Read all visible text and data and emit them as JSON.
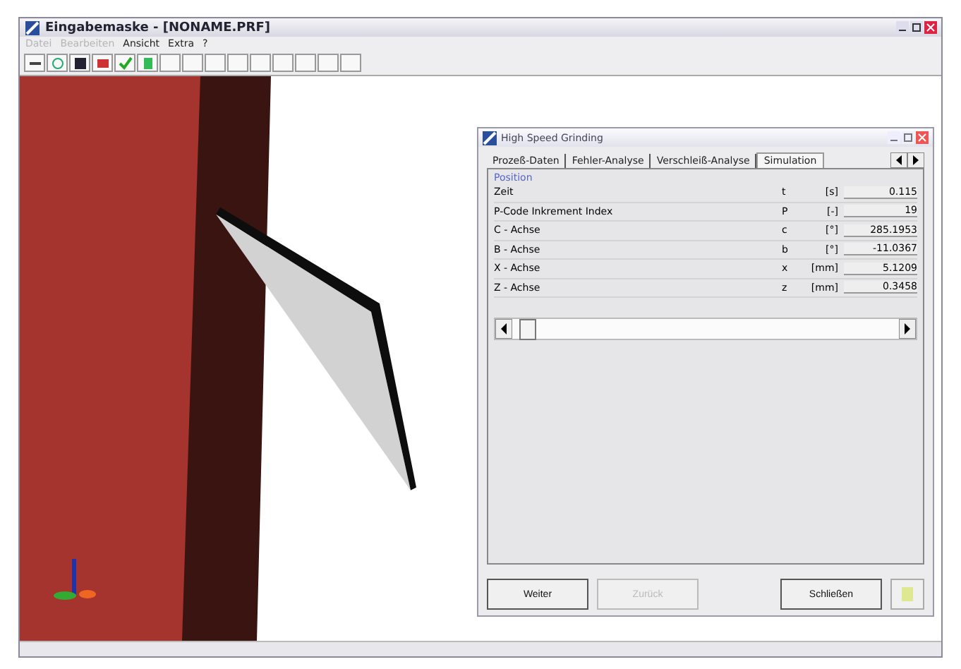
{
  "window": {
    "title": "Eingabemaske - [NONAME.PRF]"
  },
  "menu": [
    {
      "label": "Datei",
      "disabled": true
    },
    {
      "label": "Bearbeiten",
      "disabled": true
    },
    {
      "label": "Ansicht",
      "disabled": false
    },
    {
      "label": "Extra",
      "disabled": false
    },
    {
      "label": "?",
      "disabled": false
    }
  ],
  "dialog": {
    "title": "High Speed Grinding",
    "tabs": [
      {
        "label": "Prozeß-Daten",
        "selected": false
      },
      {
        "label": "Fehler-Analyse",
        "selected": false
      },
      {
        "label": "Verschleiß-Analyse",
        "selected": false
      },
      {
        "label": "Simulation",
        "selected": true
      }
    ],
    "group": "Position",
    "rows": [
      {
        "name": "Zeit",
        "symbol": "t",
        "unit": "[s]",
        "value": "0.115"
      },
      {
        "name": "P-Code Inkrement Index",
        "symbol": "P",
        "unit": "[-]",
        "value": "19"
      },
      {
        "name": "C - Achse",
        "symbol": "c",
        "unit": "[°]",
        "value": "285.1953"
      },
      {
        "name": "B - Achse",
        "symbol": "b",
        "unit": "[°]",
        "value": "-11.0367"
      },
      {
        "name": "X - Achse",
        "symbol": "x",
        "unit": "[mm]",
        "value": "5.1209"
      },
      {
        "name": "Z - Achse",
        "symbol": "z",
        "unit": "[mm]",
        "value": "0.3458"
      }
    ],
    "slider": {
      "level": 0.02
    },
    "buttons": [
      {
        "label": "Weiter",
        "disabled": false
      },
      {
        "label": "Zurück",
        "disabled": true
      },
      {
        "label": "Schließen",
        "disabled": false
      }
    ]
  }
}
